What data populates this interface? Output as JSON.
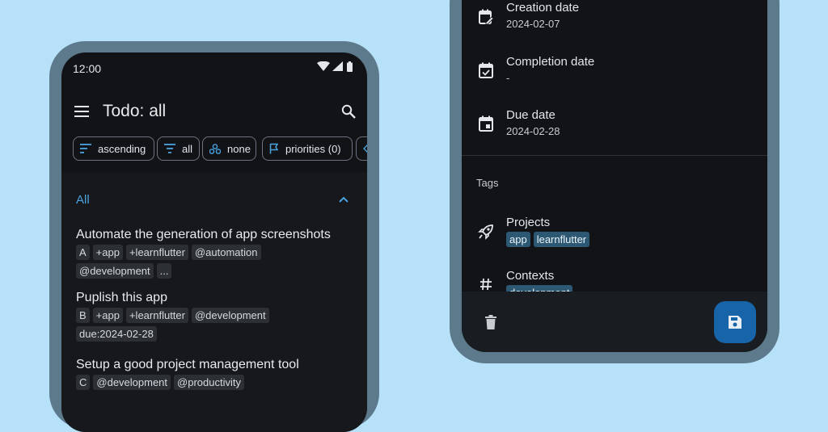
{
  "left_phone": {
    "status_time": "12:00",
    "app_title": "Todo: all",
    "filters": [
      {
        "label": "ascending"
      },
      {
        "label": "all"
      },
      {
        "label": "none"
      },
      {
        "label": "priorities (0)"
      }
    ],
    "section": {
      "label": "All"
    },
    "todos": [
      {
        "title": "Automate the generation of app screenshots",
        "tags": [
          "A",
          "+app",
          "+learnflutter",
          "@automation",
          "@development",
          "..."
        ]
      },
      {
        "title": "Puplish this app",
        "tags": [
          "B",
          "+app",
          "+learnflutter",
          "@development",
          "due:2024-02-28"
        ]
      },
      {
        "title": "Setup a good project management tool",
        "tags": [
          "C",
          "@development",
          "@productivity"
        ]
      }
    ]
  },
  "right_phone": {
    "dates": [
      {
        "label": "Creation date",
        "value": "2024-02-07",
        "icon": "calendar-edit-icon"
      },
      {
        "label": "Completion date",
        "value": "-",
        "icon": "calendar-check-icon"
      },
      {
        "label": "Due date",
        "value": "2024-02-28",
        "icon": "calendar-event-icon"
      }
    ],
    "tags_header": "Tags",
    "projects": {
      "label": "Projects",
      "tags": [
        "app",
        "learnflutter"
      ]
    },
    "contexts": {
      "label": "Contexts",
      "tags": [
        "development"
      ]
    }
  },
  "colors": {
    "background": "#b7e1f8",
    "phone_frame": "#5d7a8c",
    "screen": "#111316",
    "accent": "#4aa3df",
    "save_button": "#1864a8"
  }
}
